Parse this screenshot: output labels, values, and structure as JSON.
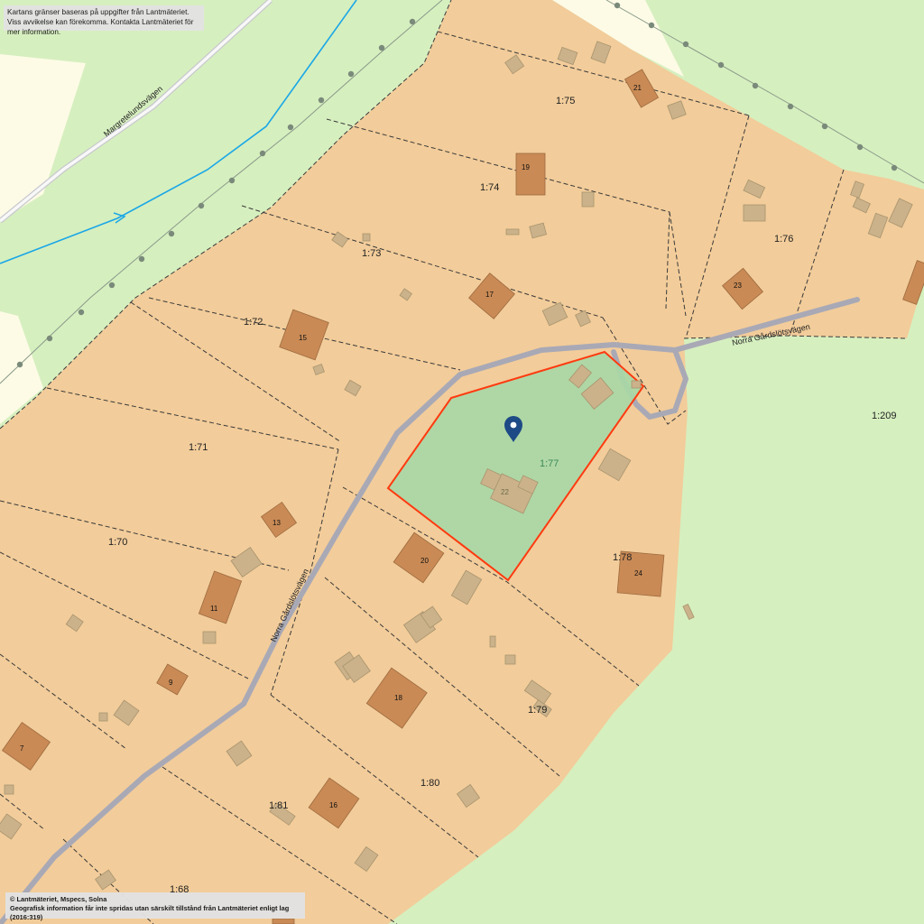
{
  "notice": {
    "line1": "Kartans gränser baseras på uppgifter från Lantmäteriet.",
    "line2": "Viss avvikelse kan förekomma. Kontakta Lantmäteriet för mer information."
  },
  "copyright": {
    "line1": "© Lantmäteriet, Mspecs, Solna",
    "line2": "Geografisk information får inte spridas utan särskilt tillstånd från Lantmäteriet enligt lag (2016:319)"
  },
  "roads": {
    "margretelund": "Margretelundsvägen",
    "gardsjo_upper": "Norra Gårdslötsvägen",
    "gardsjo_lower": "Norra Gårdslötsvägen"
  },
  "parcels": [
    "1:75",
    "1:74",
    "1:73",
    "1:72",
    "1:71",
    "1:70",
    "1:76",
    "1:209",
    "1:77",
    "1:78",
    "1:79",
    "1:80",
    "1:81",
    "1:68"
  ],
  "house_numbers": [
    "21",
    "19",
    "17",
    "15",
    "13",
    "11",
    "9",
    "7",
    "23",
    "22",
    "20",
    "24",
    "18",
    "16"
  ],
  "selected_parcel": "1:77",
  "marker_icon": "location-pin-icon",
  "colors": {
    "background": "#d6efbf",
    "parcel_fill": "#f2cc9a",
    "road": "#a9a9b6",
    "building_main": "#c98a55",
    "building_aux": "#cbb28a",
    "selected_outline": "#ff3a10",
    "selected_fill": "#a7d8a6",
    "pin": "#1e4a86",
    "water": "#1aa7e6"
  }
}
